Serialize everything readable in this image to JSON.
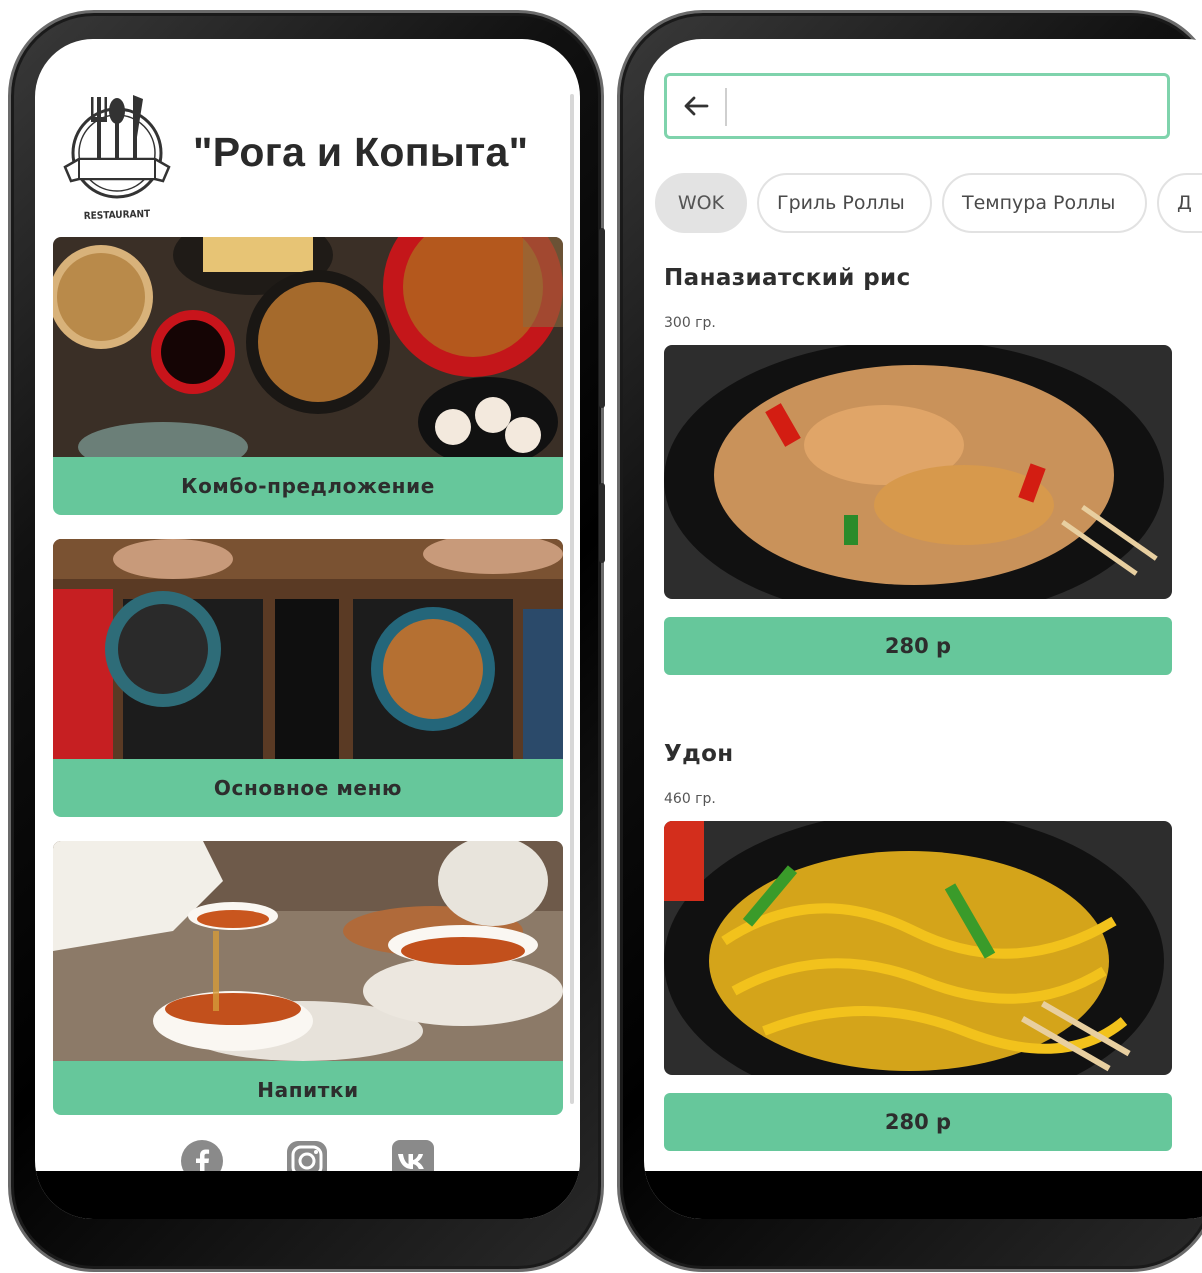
{
  "left_screen": {
    "app_title": "\"Рога и Копыта\"",
    "logo_text": "RESTAURANT",
    "categories": [
      {
        "label": "Комбо-предложение"
      },
      {
        "label": "Основное меню"
      },
      {
        "label": "Напитки"
      }
    ],
    "social_icons": [
      "facebook-icon",
      "instagram-icon",
      "vk-icon"
    ]
  },
  "right_screen": {
    "search": {
      "value": "",
      "placeholder": ""
    },
    "filter_chips": [
      "WOK",
      "Гриль Роллы",
      "Темпура Роллы",
      "Д"
    ],
    "active_chip": "WOK",
    "dishes": [
      {
        "name": "Паназиатский рис",
        "weight": "300 гр.",
        "price": "280 р"
      },
      {
        "name": "Удон",
        "weight": "460 гр.",
        "price": "280 р"
      }
    ]
  },
  "colors": {
    "accent": "#66c79b",
    "search_border": "#7fd3ac",
    "chip_active": "#e3e3e3"
  }
}
